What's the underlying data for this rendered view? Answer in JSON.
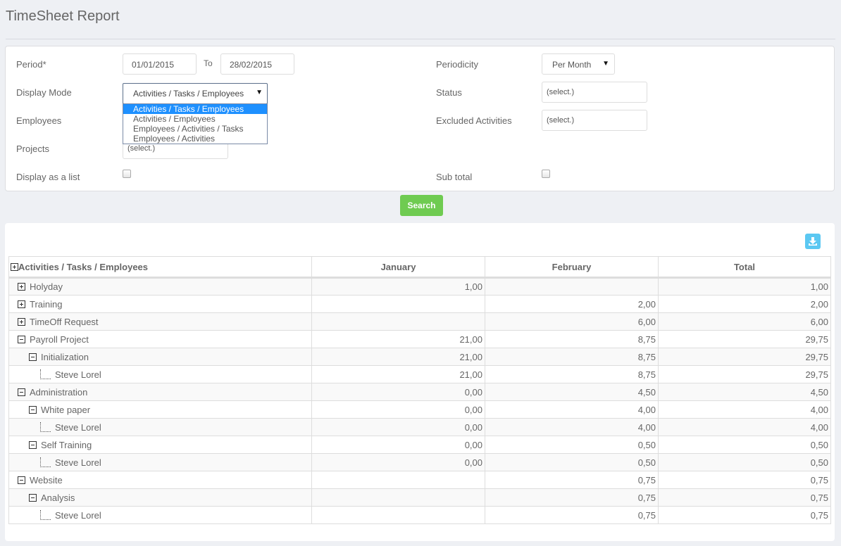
{
  "title": "TimeSheet Report",
  "form": {
    "period_label": "Period*",
    "period_from": "01/01/2015",
    "to_label": "To",
    "period_to": "28/02/2015",
    "display_mode_label": "Display Mode",
    "display_mode_value": "Activities / Tasks / Employees",
    "display_mode_options": [
      "Activities / Tasks / Employees",
      "Activities / Employees",
      "Employees / Activities / Tasks",
      "Employees / Activities"
    ],
    "employees_label": "Employees",
    "projects_label": "Projects",
    "projects_value": "(select.)",
    "display_list_label": "Display as a list",
    "periodicity_label": "Periodicity",
    "periodicity_value": "Per Month",
    "status_label": "Status",
    "status_value": "(select.)",
    "excluded_label": "Excluded Activities",
    "excluded_value": "(select.)",
    "subtotal_label": "Sub total",
    "search_label": "Search"
  },
  "colors": {
    "search": "#6fcb51",
    "download": "#5bc8f2",
    "selected_option": "#1e90ff"
  },
  "table": {
    "headers": [
      "Activities / Tasks / Employees",
      "January",
      "February",
      "Total"
    ],
    "rows": [
      {
        "level": 0,
        "icon": "plus",
        "label": "Holyday",
        "jan": "1,00",
        "feb": "",
        "total": "1,00"
      },
      {
        "level": 0,
        "icon": "plus",
        "label": "Training",
        "jan": "",
        "feb": "2,00",
        "total": "2,00"
      },
      {
        "level": 0,
        "icon": "plus",
        "label": "TimeOff Request",
        "jan": "",
        "feb": "6,00",
        "total": "6,00"
      },
      {
        "level": 0,
        "icon": "minus",
        "label": "Payroll Project",
        "jan": "21,00",
        "feb": "8,75",
        "total": "29,75"
      },
      {
        "level": 1,
        "icon": "minus",
        "label": "Initialization",
        "jan": "21,00",
        "feb": "8,75",
        "total": "29,75"
      },
      {
        "level": 2,
        "icon": "leaf",
        "label": "Steve Lorel",
        "jan": "21,00",
        "feb": "8,75",
        "total": "29,75"
      },
      {
        "level": 0,
        "icon": "minus",
        "label": "Administration",
        "jan": "0,00",
        "feb": "4,50",
        "total": "4,50"
      },
      {
        "level": 1,
        "icon": "minus",
        "label": "White paper",
        "jan": "0,00",
        "feb": "4,00",
        "total": "4,00"
      },
      {
        "level": 2,
        "icon": "leaf",
        "label": "Steve Lorel",
        "jan": "0,00",
        "feb": "4,00",
        "total": "4,00"
      },
      {
        "level": 1,
        "icon": "minus",
        "label": "Self Training",
        "jan": "0,00",
        "feb": "0,50",
        "total": "0,50"
      },
      {
        "level": 2,
        "icon": "leaf",
        "label": "Steve Lorel",
        "jan": "0,00",
        "feb": "0,50",
        "total": "0,50"
      },
      {
        "level": 0,
        "icon": "minus",
        "label": "Website",
        "jan": "",
        "feb": "0,75",
        "total": "0,75"
      },
      {
        "level": 1,
        "icon": "minus",
        "label": "Analysis",
        "jan": "",
        "feb": "0,75",
        "total": "0,75"
      },
      {
        "level": 2,
        "icon": "leaf",
        "label": "Steve Lorel",
        "jan": "",
        "feb": "0,75",
        "total": "0,75"
      }
    ]
  }
}
